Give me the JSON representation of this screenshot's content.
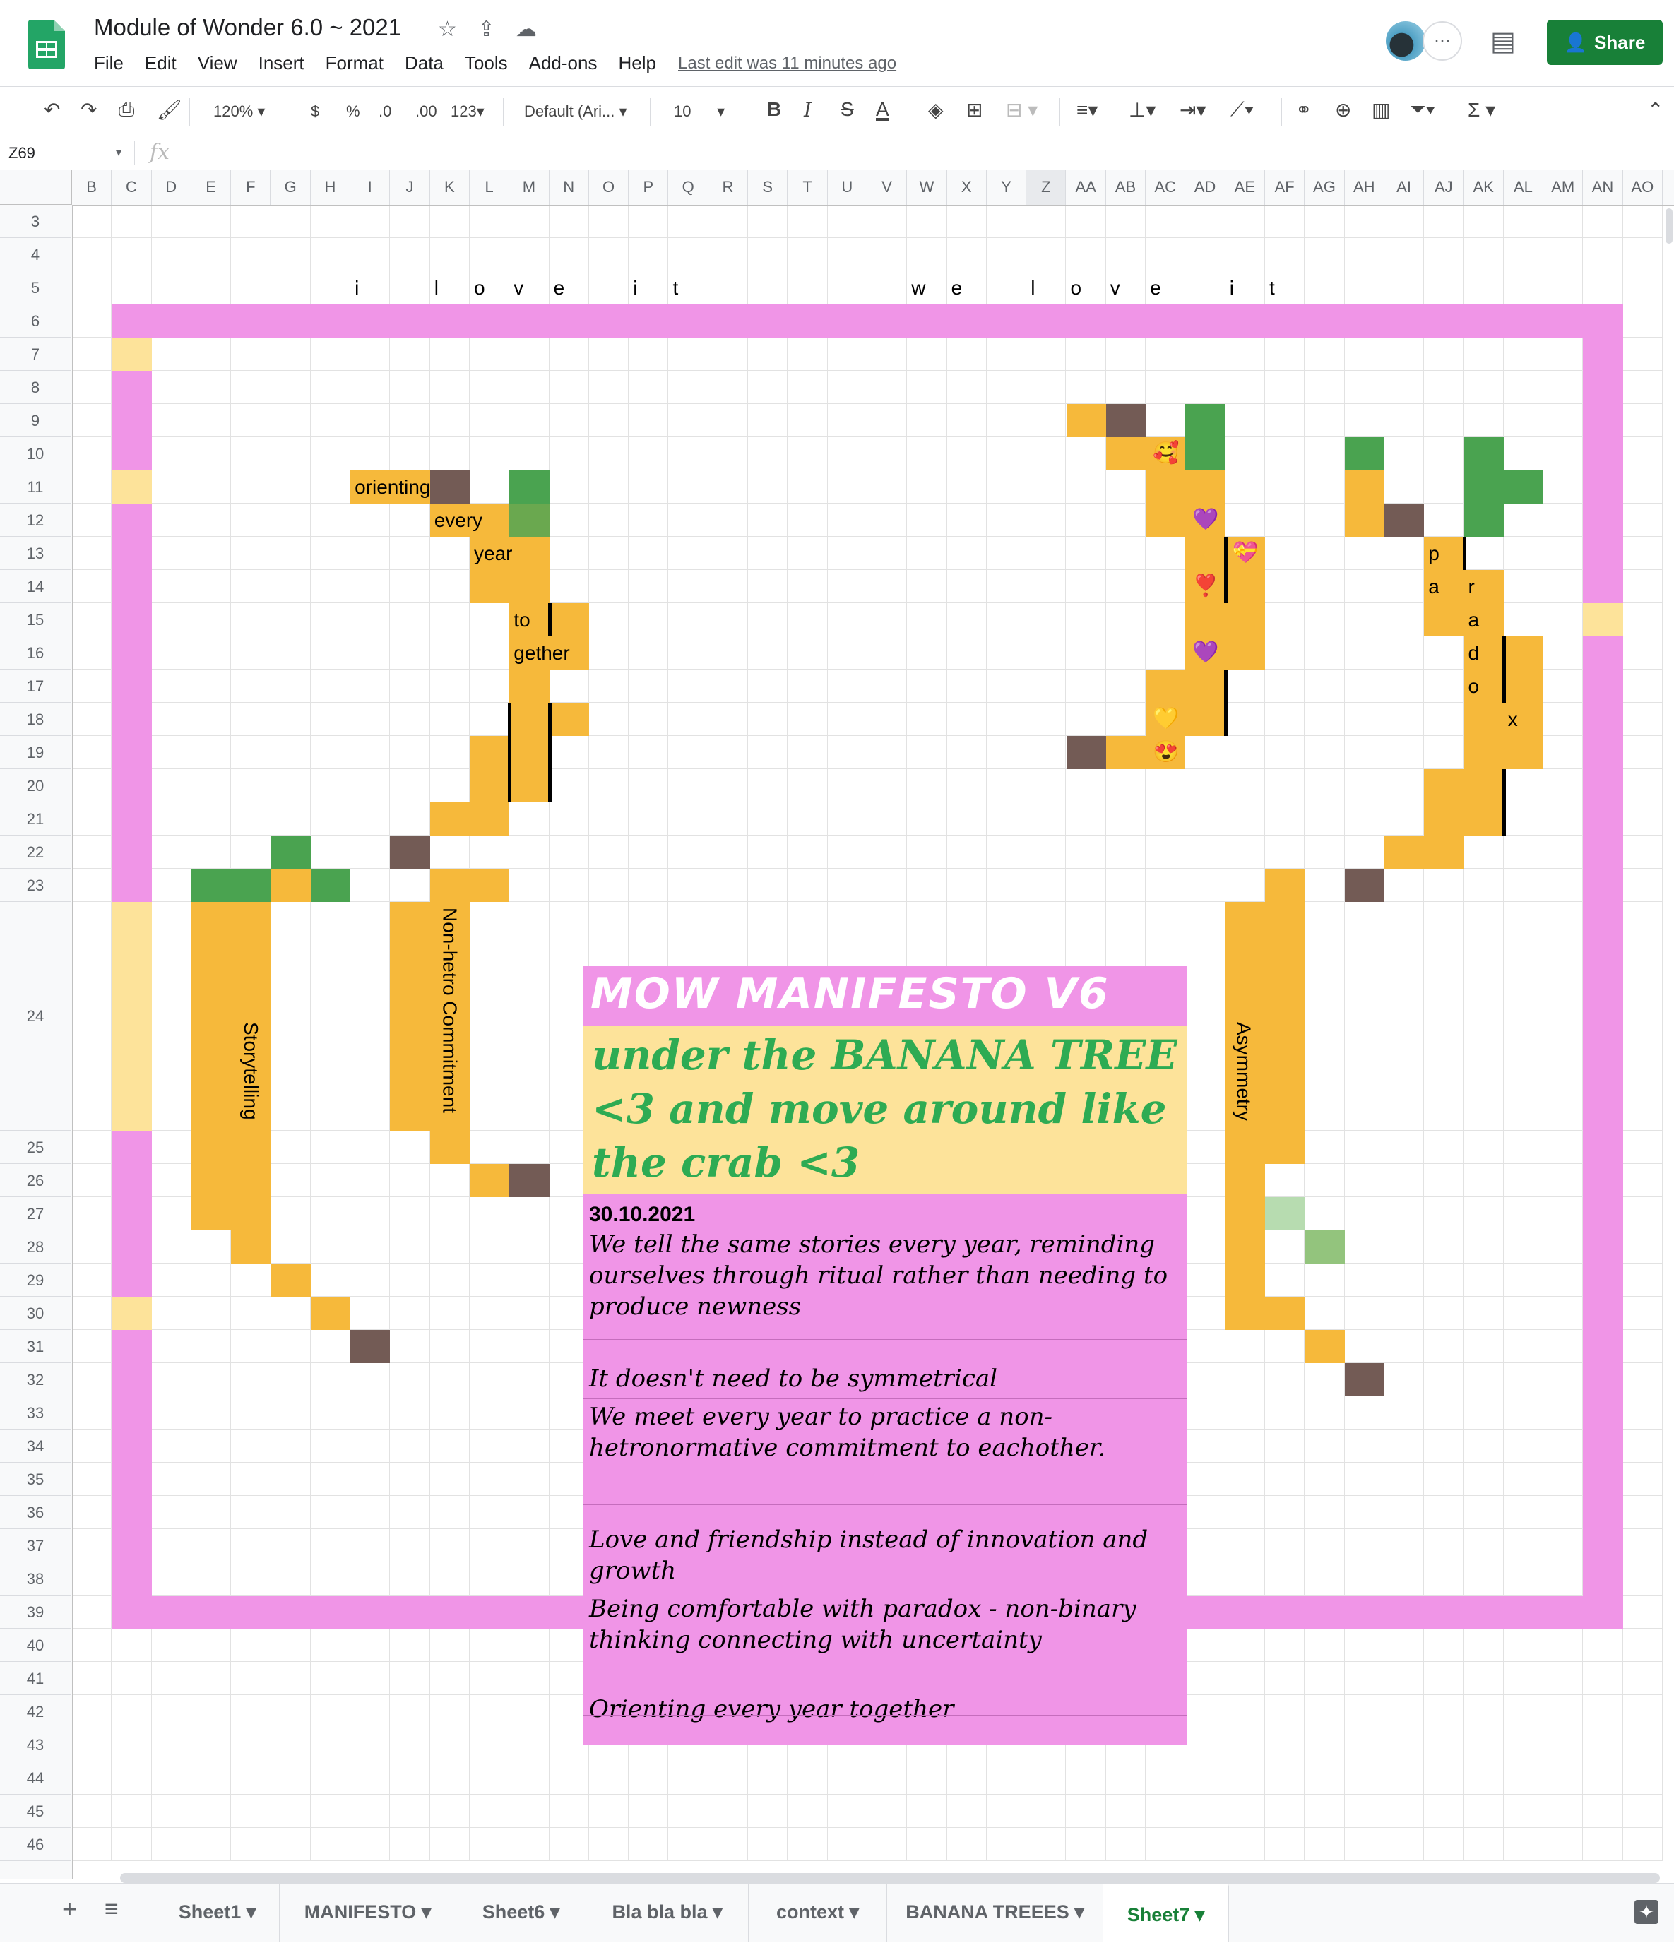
{
  "app": {
    "title": "Module of Wonder 6.0 ~ 2021",
    "menu": [
      "File",
      "Edit",
      "View",
      "Insert",
      "Format",
      "Data",
      "Tools",
      "Add-ons",
      "Help"
    ],
    "last_edit": "Last edit was 11 minutes ago",
    "share_label": "Share"
  },
  "toolbar": {
    "zoom": "120%",
    "currency": "$",
    "percent": "%",
    "decrease_decimal": ".0",
    "increase_decimal": ".00",
    "more_formats": "123",
    "font": "Default (Ari...",
    "font_size": "10",
    "bold": "B",
    "italic": "I",
    "strike": "S",
    "text_color": "A",
    "sum": "Σ"
  },
  "formula_bar": {
    "name_box": "Z69",
    "fx": "fx"
  },
  "columns": [
    "B",
    "C",
    "D",
    "E",
    "F",
    "G",
    "H",
    "I",
    "J",
    "K",
    "L",
    "M",
    "N",
    "O",
    "P",
    "Q",
    "R",
    "S",
    "T",
    "U",
    "V",
    "W",
    "X",
    "Y",
    "Z",
    "AA",
    "AB",
    "AC",
    "AD",
    "AE",
    "AF",
    "AG",
    "AH",
    "AI",
    "AJ",
    "AK",
    "AL",
    "AM",
    "AN",
    "AO"
  ],
  "rows": [
    "3",
    "4",
    "5",
    "6",
    "7",
    "8",
    "9",
    "10",
    "11",
    "12",
    "13",
    "14",
    "15",
    "16",
    "17",
    "18",
    "19",
    "20",
    "21",
    "22",
    "23",
    "24",
    "25",
    "26",
    "27",
    "28",
    "29",
    "30",
    "31",
    "32",
    "33",
    "34",
    "35",
    "36",
    "37",
    "38",
    "39",
    "40",
    "41",
    "42",
    "43",
    "44",
    "45",
    "46"
  ],
  "row5_letters": {
    "I": "i",
    "K": "l",
    "L": "o",
    "M": "v",
    "N": "e",
    "P": "i",
    "Q": "t",
    "W": "w",
    "X": "e",
    "Z": "l",
    "AA": "o",
    "AB": "v",
    "AC": "e",
    "AE": "i",
    "AF": "t"
  },
  "left_tree_words": [
    "orienting",
    "every",
    "year",
    "to",
    "gether"
  ],
  "right_tree_letters": [
    "p",
    "a",
    "r",
    "a",
    "d",
    "o",
    "x"
  ],
  "trunk_labels": {
    "storytelling": "Storytelling",
    "non_hetro": "Non-hetro Commitment",
    "asymmetry": "Asymmetry"
  },
  "emojis": {
    "smiling_hearts": "🥰",
    "purple_heart": "💜",
    "heart_ribbon": "💝",
    "red_exclamation_heart": "❣️",
    "yellow_heart": "💛",
    "heart_eyes": "😍"
  },
  "manifesto": {
    "title": "MOW MANIFESTO V6",
    "subtitle": "under the BANANA TREE <3 and move around like the crab <3",
    "date": "30.10.2021",
    "points": [
      "We tell the same stories every year, reminding ourselves through ritual rather than needing to produce newness",
      "It doesn't need to be symmetrical",
      "We meet every year to practice a non-hetronormative commitment to eachother.",
      "Love and friendship instead of innovation and growth",
      "Being comfortable with paradox - non-binary thinking connecting with uncertainty",
      "Orienting every year together"
    ]
  },
  "sheets": [
    "Sheet1",
    "MANIFESTO",
    "Sheet6",
    "Bla bla bla",
    "context",
    "BANANA TREEES",
    "Sheet7"
  ],
  "active_sheet": "Sheet7",
  "colors": {
    "pink": "#f095e7",
    "orange": "#f6b93b",
    "green": "#4aa350",
    "brown": "#735b55",
    "pale_yellow": "#fde39a",
    "light_green": "#b7dcb0",
    "mid_green": "#93c47d",
    "share_green": "#188038"
  }
}
